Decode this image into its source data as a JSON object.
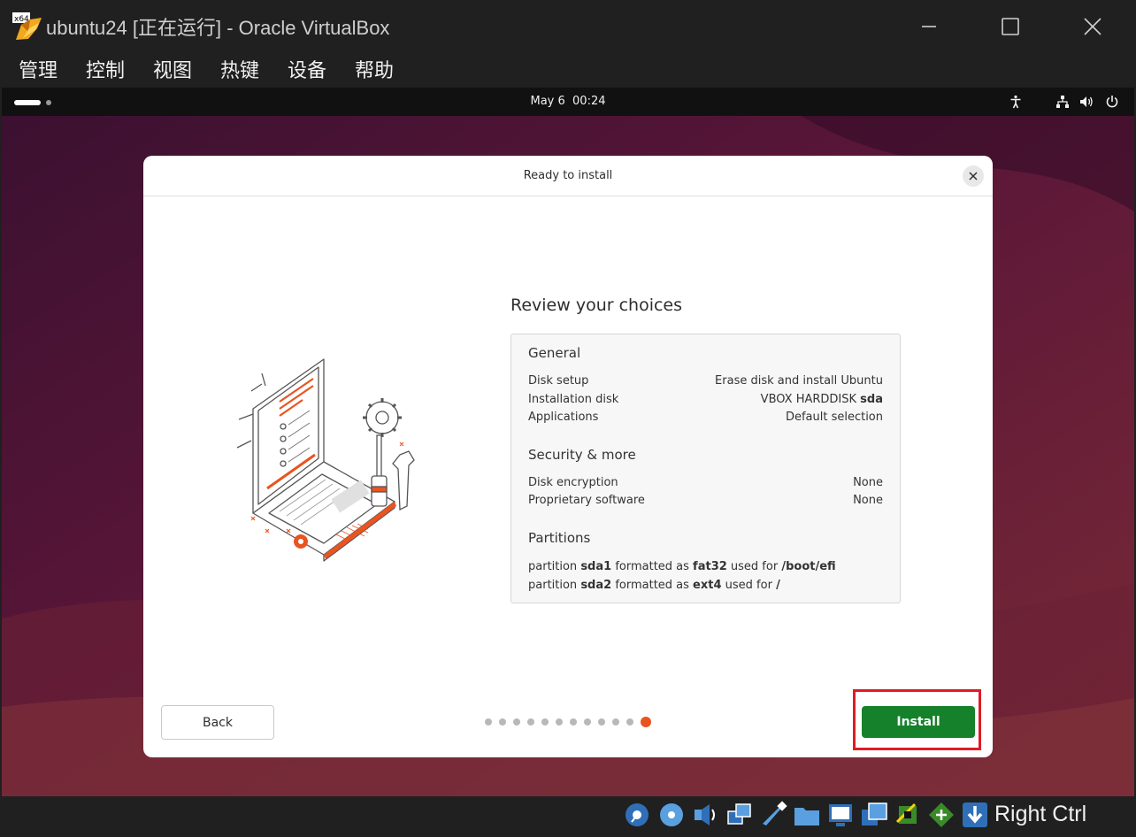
{
  "window": {
    "title": "ubuntu24 [正在运行] - Oracle VirtualBox",
    "logo_badge": "x64"
  },
  "menu": [
    "管理",
    "控制",
    "视图",
    "热键",
    "设备",
    "帮助"
  ],
  "guest": {
    "clock": "May 6  00:24",
    "tray_icons": [
      "accessibility-icon",
      "network-icon",
      "volume-icon",
      "power-icon"
    ]
  },
  "dialog": {
    "title": "Ready to install",
    "heading": "Review your choices",
    "general": {
      "title": "General",
      "rows": [
        {
          "label": "Disk setup",
          "value": "Erase disk and install Ubuntu"
        },
        {
          "label": "Installation disk",
          "value_prefix": "VBOX HARDDISK ",
          "value_bold": "sda"
        },
        {
          "label": "Applications",
          "value": "Default selection"
        }
      ]
    },
    "security": {
      "title": "Security & more",
      "rows": [
        {
          "label": "Disk encryption",
          "value": "None"
        },
        {
          "label": "Proprietary software",
          "value": "None"
        }
      ]
    },
    "partitions": {
      "title": "Partitions",
      "lines": [
        {
          "p1": "partition ",
          "b1": "sda1",
          "p2": " formatted as ",
          "b2": "fat32",
          "p3": " used for ",
          "b3": "/boot/efi"
        },
        {
          "p1": "partition ",
          "b1": "sda2",
          "p2": " formatted as ",
          "b2": "ext4",
          "p3": " used for ",
          "b3": "/"
        }
      ]
    },
    "back_label": "Back",
    "install_label": "Install",
    "progress": {
      "total_steps": 12,
      "current_step": 12
    }
  },
  "statusbar": {
    "host_key": "Right Ctrl",
    "icons": [
      "hard-disk-icon",
      "optical-disc-icon",
      "audio-icon",
      "network-adapters-icon",
      "usb-icon",
      "shared-folders-icon",
      "display-icon",
      "recording-icon",
      "cpu-icon",
      "mouse-integration-icon",
      "host-key-arrow-icon"
    ]
  },
  "colors": {
    "accent_orange": "#e95420",
    "install_green": "#15812b",
    "highlight_red": "#e01b24"
  }
}
